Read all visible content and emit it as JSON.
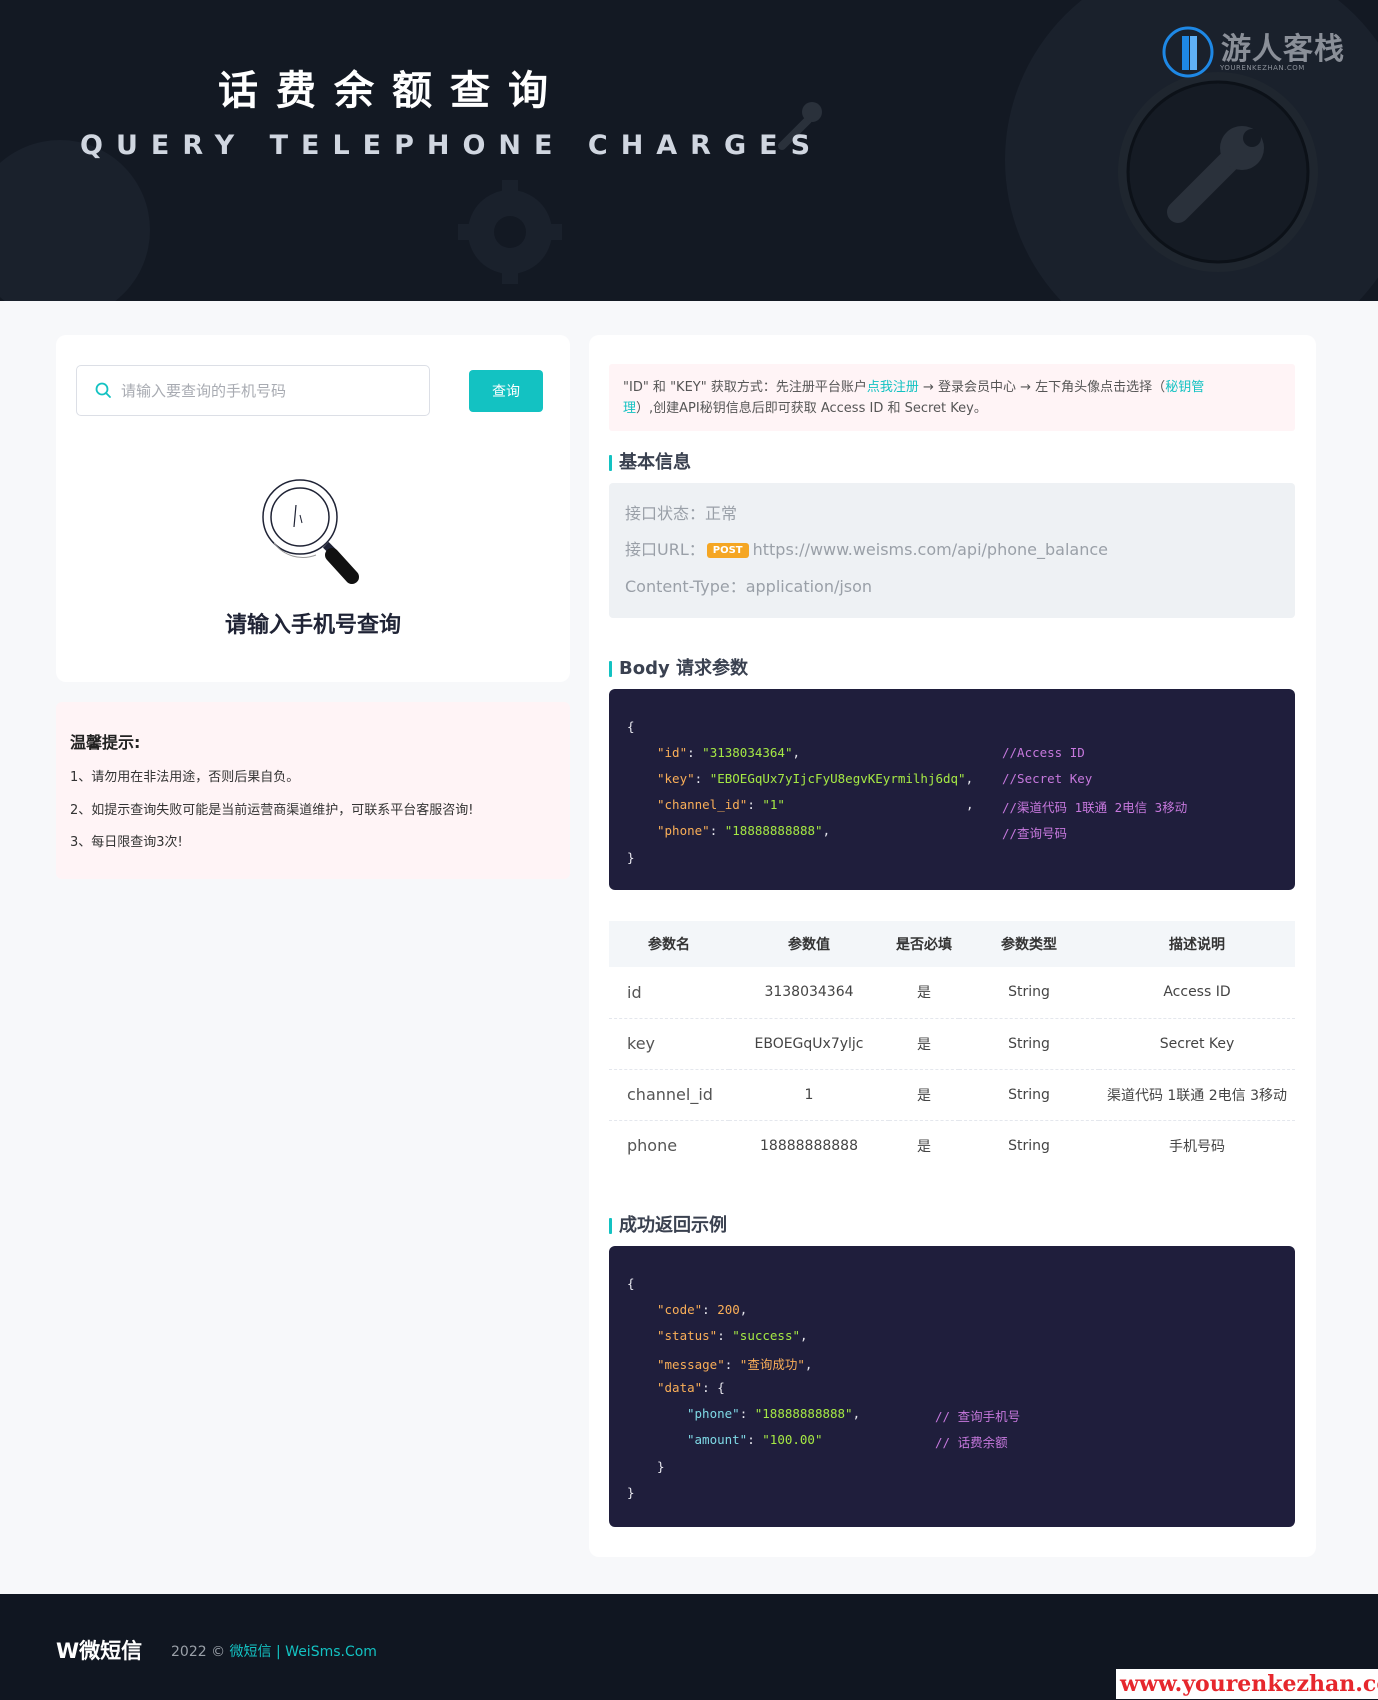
{
  "header": {
    "title": "话费余额查询",
    "subtitle": "QUERY TELEPHONE CHARGES",
    "logo_name": "游人客栈",
    "logo_domain": "YOURENKEZHAN.COM"
  },
  "search": {
    "placeholder": "请输入要查询的手机号码",
    "button_label": "查询",
    "empty_text": "请输入手机号查询"
  },
  "tips": {
    "title": "温馨提示:",
    "items": [
      "1、请勿用在非法用途，否则后果自负。",
      "2、如提示查询失败可能是当前运营商渠道维护，可联系平台客服咨询!",
      "3、每日限查询3次!"
    ]
  },
  "notice": {
    "text_1": "\"ID\" 和 \"KEY\" 获取方式：先注册平台账户",
    "link_register": "点我注册",
    "text_2": " → 登录会员中心 → 左下角头像点击选择（",
    "link_key_a": "秘钥管",
    "link_key_b": "理",
    "text_3": "）,创建API秘钥信息后即可获取 Access ID 和 Secret Key。"
  },
  "basic_info": {
    "section_title": "基本信息",
    "status_label": "接口状态：",
    "status_value": "正常",
    "url_label": "接口URL：",
    "method_badge": "POST",
    "url_value": "https://www.weisms.com/api/phone_balance",
    "content_type_label": "Content-Type：",
    "content_type_value": "application/json"
  },
  "body_params": {
    "section_title": "Body 请求参数",
    "code": {
      "open": "{",
      "close": "}",
      "lines": [
        {
          "key": "\"id\"",
          "value": "\"3138034364\"",
          "tail": ",",
          "comment": "//Access ID"
        },
        {
          "key": "\"key\"",
          "value": "\"EBOEGqUx7yIjcFyU8egvKEyrmilhj6dq\"",
          "tail": ",",
          "comment": "//Secret Key"
        },
        {
          "key": "\"channel_id\"",
          "value": "\"1\"",
          "tail": ",",
          "comment": "//渠道代码 1联通 2电信 3移动"
        },
        {
          "key": "\"phone\"",
          "value": "\"18888888888\"",
          "tail": ",",
          "comment": "//查询号码"
        }
      ]
    },
    "table": {
      "headers": [
        "参数名",
        "参数值",
        "是否必填",
        "参数类型",
        "描述说明"
      ],
      "rows": [
        [
          "id",
          "3138034364",
          "是",
          "String",
          "Access ID"
        ],
        [
          "key",
          "EBOEGqUx7yljc",
          "是",
          "String",
          "Secret Key"
        ],
        [
          "channel_id",
          "1",
          "是",
          "String",
          "渠道代码 1联通 2电信 3移动"
        ],
        [
          "phone",
          "18888888888",
          "是",
          "String",
          "手机号码"
        ]
      ]
    }
  },
  "response": {
    "section_title": "成功返回示例",
    "code": {
      "open": "{",
      "close": "}",
      "code_key": "\"code\"",
      "code_value": "200",
      "status_key": "\"status\"",
      "status_value": "\"success\"",
      "message_key": "\"message\"",
      "message_value": "\"查询成功\"",
      "data_key": "\"data\"",
      "phone_key": "\"phone\"",
      "phone_value": "\"18888888888\"",
      "phone_comment": "// 查询手机号",
      "amount_key": "\"amount\"",
      "amount_value": "\"100.00\"",
      "amount_comment": "// 话费余额"
    }
  },
  "footer": {
    "brand": "W微短信",
    "year": "2022 ©",
    "link_name": "微短信",
    "sep": " | ",
    "link_domain": "WeiSms.Com"
  },
  "watermark": "www.yourenkezhan.com",
  "colors": {
    "accent": "#13c2c2",
    "header_bg": "#131923",
    "code_bg": "#1f1e3c",
    "post_badge": "#f5a623",
    "notice_bg": "#fff4f6"
  }
}
